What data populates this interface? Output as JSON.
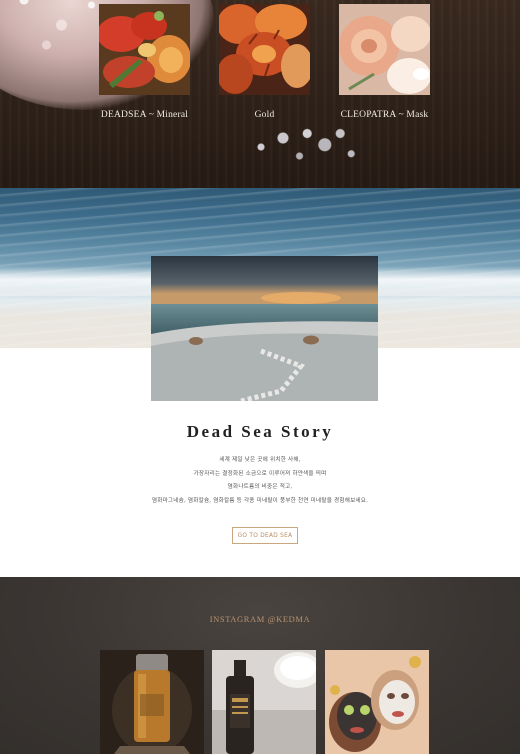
{
  "products": [
    {
      "label": "DEADSEA ~ Mineral",
      "image": "red-orange-flowers-photo"
    },
    {
      "label": "Gold",
      "image": "orange-lilies-photo"
    },
    {
      "label": "CLEOPATRA ~ Mask",
      "image": "peach-roses-photo"
    }
  ],
  "story": {
    "title": "Dead Sea Story",
    "lines": [
      "세계 제일 낮은 곳에 위치한 사해,",
      "가장자리는 결정화된 소금으로 이루어져 하얀색을 띄며",
      "염화나트륨의 비중은 적고,",
      "염화마그네슘, 염화칼슘, 염화칼륨 등 각종 미네랄이 풍부한 천연 미네랄을 경험해보세요."
    ],
    "button_label": "GO TO DEAD SEA"
  },
  "instagram": {
    "title": "INSTAGRAM @KEDMA",
    "photos": [
      "amber-serum-bottle-photo",
      "black-mud-shampoo-photo",
      "face-mask-women-photo"
    ]
  },
  "colors": {
    "accent": "#b88b5e",
    "wood_dark": "#2e2119",
    "insta_bg": "#3a3532"
  }
}
